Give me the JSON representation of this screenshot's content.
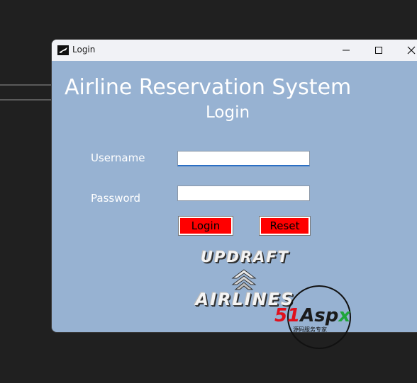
{
  "window": {
    "title": "Login",
    "controls": [
      "minimize-icon",
      "maximize-icon",
      "close-icon"
    ]
  },
  "form": {
    "heading": "Airline Reservation System",
    "subheading": "Login",
    "username_label": "Username",
    "username_value": "",
    "password_label": "Password",
    "password_value": "",
    "login_button": "Login",
    "reset_button": "Reset"
  },
  "logo": {
    "line1": "UPDRAFT",
    "line2": "AIRLINES"
  },
  "watermark": {
    "brand_part1": "51",
    "brand_part2": "Asp",
    "brand_part3": "x",
    "tagline": "源码服务专家"
  },
  "colors": {
    "window_bg": "#97b2d2",
    "button_bg": "#ff0000",
    "titlebar_bg": "#f1f2f6"
  }
}
